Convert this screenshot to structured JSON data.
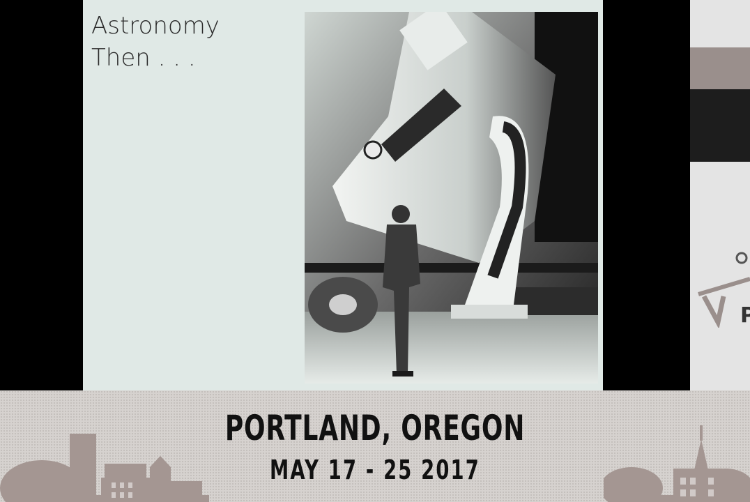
{
  "slide": {
    "title_line1": "Astronomy",
    "title_line2": "Then . . ."
  },
  "photo": {
    "subject": "telescope-photo"
  },
  "banner": {
    "location": "PORTLAND, OREGON",
    "dates": "MAY 17 - 25 2017",
    "right_letter": "P"
  },
  "colors": {
    "slide_background": "#e0e9e6",
    "banner_background": "#d6d2cf",
    "skyline": "#a49692",
    "text": "#111111"
  }
}
